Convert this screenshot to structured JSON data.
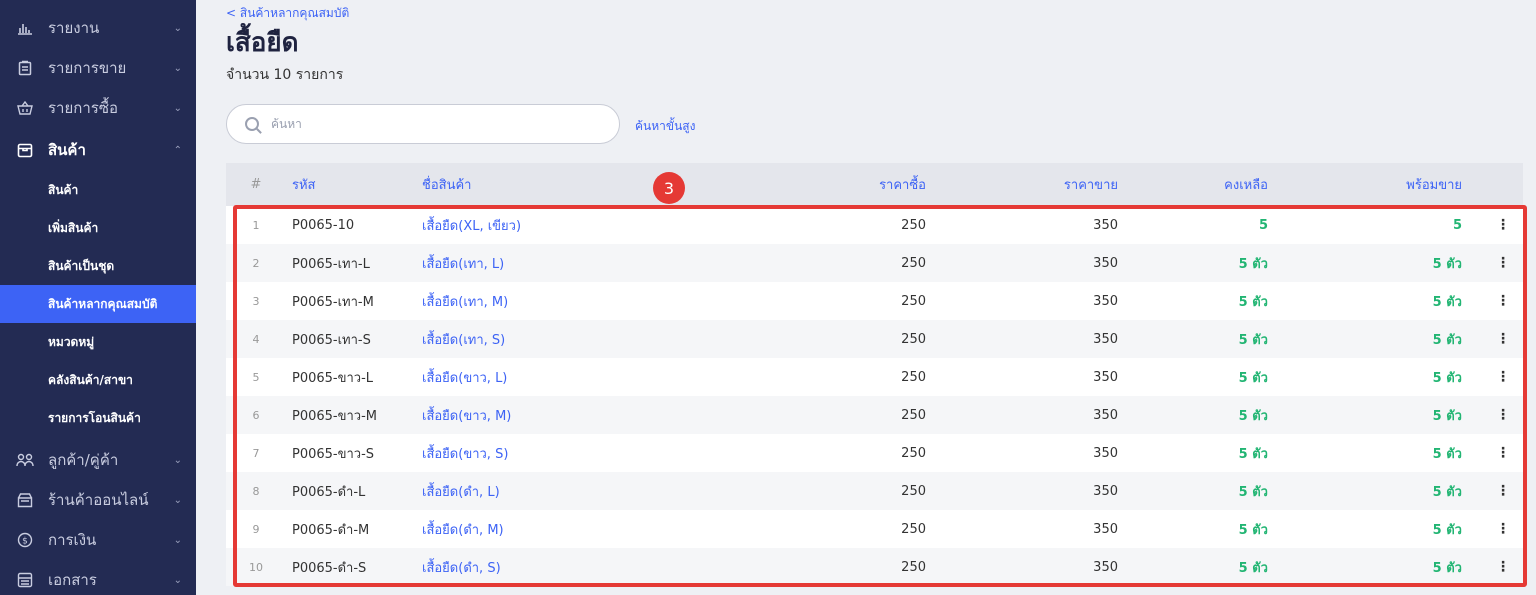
{
  "sidebar": {
    "items": [
      {
        "label": "รายงาน",
        "icon": "bar-chart-icon"
      },
      {
        "label": "รายการขาย",
        "icon": "clipboard-icon"
      },
      {
        "label": "รายการซื้อ",
        "icon": "basket-icon"
      },
      {
        "label": "สินค้า",
        "icon": "box-icon"
      },
      {
        "label": "ลูกค้า/คู่ค้า",
        "icon": "users-icon"
      },
      {
        "label": "ร้านค้าออนไลน์",
        "icon": "shop-icon"
      },
      {
        "label": "การเงิน",
        "icon": "coin-icon"
      },
      {
        "label": "เอกสาร",
        "icon": "document-icon"
      }
    ],
    "sub_items": [
      "สินค้า",
      "เพิ่มสินค้า",
      "สินค้าเป็นชุด",
      "สินค้าหลากคุณสมบัติ",
      "หมวดหมู่",
      "คลังสินค้า/สาขา",
      "รายการโอนสินค้า"
    ]
  },
  "header": {
    "breadcrumb": "< สินค้าหลากคุณสมบัติ",
    "title": "เสื้อยืด",
    "count": "จำนวน 10 รายการ"
  },
  "search": {
    "placeholder": "ค้นหา",
    "advanced": "ค้นหาขั้นสูง"
  },
  "table": {
    "headers": {
      "num": "#",
      "code": "รหัส",
      "name": "ชื่อสินค้า",
      "buy": "ราคาซื้อ",
      "sell": "ราคาขาย",
      "remain": "คงเหลือ",
      "ready": "พร้อมขาย"
    },
    "rows": [
      {
        "num": "1",
        "code": "P0065-10",
        "name": "เสื้อยืด(XL, เขียว)",
        "buy": "250",
        "sell": "350",
        "remain": "5",
        "ready": "5"
      },
      {
        "num": "2",
        "code": "P0065-เทา-L",
        "name": "เสื้อยืด(เทา, L)",
        "buy": "250",
        "sell": "350",
        "remain": "5 ตัว",
        "ready": "5 ตัว"
      },
      {
        "num": "3",
        "code": "P0065-เทา-M",
        "name": "เสื้อยืด(เทา, M)",
        "buy": "250",
        "sell": "350",
        "remain": "5 ตัว",
        "ready": "5 ตัว"
      },
      {
        "num": "4",
        "code": "P0065-เทา-S",
        "name": "เสื้อยืด(เทา, S)",
        "buy": "250",
        "sell": "350",
        "remain": "5 ตัว",
        "ready": "5 ตัว"
      },
      {
        "num": "5",
        "code": "P0065-ขาว-L",
        "name": "เสื้อยืด(ขาว, L)",
        "buy": "250",
        "sell": "350",
        "remain": "5 ตัว",
        "ready": "5 ตัว"
      },
      {
        "num": "6",
        "code": "P0065-ขาว-M",
        "name": "เสื้อยืด(ขาว, M)",
        "buy": "250",
        "sell": "350",
        "remain": "5 ตัว",
        "ready": "5 ตัว"
      },
      {
        "num": "7",
        "code": "P0065-ขาว-S",
        "name": "เสื้อยืด(ขาว, S)",
        "buy": "250",
        "sell": "350",
        "remain": "5 ตัว",
        "ready": "5 ตัว"
      },
      {
        "num": "8",
        "code": "P0065-ดำ-L",
        "name": "เสื้อยืด(ดำ, L)",
        "buy": "250",
        "sell": "350",
        "remain": "5 ตัว",
        "ready": "5 ตัว"
      },
      {
        "num": "9",
        "code": "P0065-ดำ-M",
        "name": "เสื้อยืด(ดำ, M)",
        "buy": "250",
        "sell": "350",
        "remain": "5 ตัว",
        "ready": "5 ตัว"
      },
      {
        "num": "10",
        "code": "P0065-ดำ-S",
        "name": "เสื้อยืด(ดำ, S)",
        "buy": "250",
        "sell": "350",
        "remain": "5 ตัว",
        "ready": "5 ตัว"
      }
    ],
    "more_icon": "⋮"
  },
  "annotation": {
    "marker": "3"
  },
  "colors": {
    "sidebar": "#232b53",
    "accent": "#3d63f5",
    "stock": "#22b573",
    "highlight": "#e53935"
  }
}
